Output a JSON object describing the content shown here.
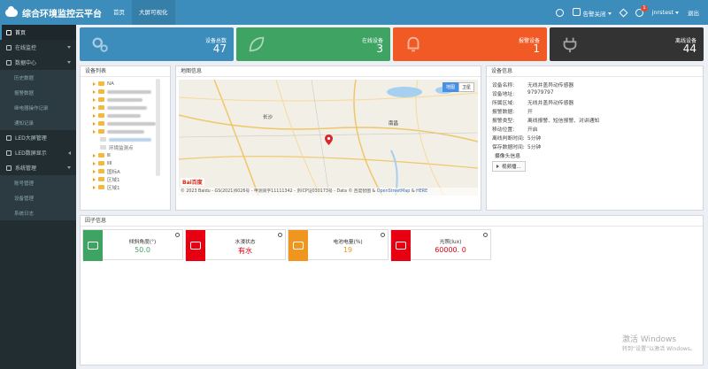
{
  "app": {
    "title": "综合环境监控云平台"
  },
  "header": {
    "tabs": [
      {
        "label": "首页"
      },
      {
        "label": "大屏可视化"
      }
    ],
    "alarm_label": "告警关闭",
    "notification_count": "1",
    "username": "jnrstest",
    "logout_label": "退出"
  },
  "sidebar": {
    "items": [
      {
        "label": "首页"
      },
      {
        "label": "在线监控"
      },
      {
        "label": "数据中心"
      },
      {
        "label": "历史数据"
      },
      {
        "label": "报警数据"
      },
      {
        "label": "继电器操作记录"
      },
      {
        "label": "通知记录"
      },
      {
        "label": "LED大屏管理"
      },
      {
        "label": "LED数屏显示"
      },
      {
        "label": "系统管理"
      },
      {
        "label": "账号管理"
      },
      {
        "label": "设备管理"
      },
      {
        "label": "系统日志"
      }
    ]
  },
  "stats": [
    {
      "label": "设备总数",
      "value": "47",
      "color": "#3c8dbc"
    },
    {
      "label": "在线设备",
      "value": "3",
      "color": "#3fa463"
    },
    {
      "label": "报警设备",
      "value": "1",
      "color": "#f15a25"
    },
    {
      "label": "离线设备",
      "value": "44",
      "color": "#333333"
    }
  ],
  "device_list": {
    "title": "设备列表",
    "tree_visible_labels": {
      "r1": "NA",
      "r9": "环境监测点",
      "r10": "Ⅲ",
      "r11": "ⅡⅡ",
      "r12": "国标A",
      "r13": "区域1",
      "r14": "区域1"
    }
  },
  "map_panel": {
    "title": "地图信息",
    "type_map": "地图",
    "type_sat": "卫星",
    "city1": "长沙",
    "city2": "南昌",
    "footer_prefix": "© 2023 Baidu - GS(2021)6026号 - 甲测资字11111342 - 京ICP证030173号 - Data © 百度智图 &",
    "footer_link1": "OpenStreetMap",
    "footer_and": "&",
    "footer_link2": "HERE",
    "logo": "Bai百度"
  },
  "device_info": {
    "title": "设备信息",
    "rows": [
      {
        "k": "设备名称:",
        "v": "无线井盖异动传感器"
      },
      {
        "k": "设备地址:",
        "v": "97979797"
      },
      {
        "k": "所属区域:",
        "v": "无线井盖异动传感器"
      },
      {
        "k": "报警数据:",
        "v": "开"
      },
      {
        "k": "报警类型:",
        "v": "离线报警、短信报警、对讲通知"
      },
      {
        "k": "移动位置:",
        "v": "开启"
      },
      {
        "k": "离线判断时间:",
        "v": "5分钟"
      },
      {
        "k": "保存数据时间:",
        "v": "5分钟"
      }
    ],
    "camera_label": "摄像头信息",
    "video_button": "视频播..."
  },
  "factor_panel": {
    "title": "因子信息"
  },
  "sensors": [
    {
      "name": "倾斜角度(°)",
      "value": "50.0",
      "color": "#3fa463"
    },
    {
      "name": "水浸状态",
      "value": "有水",
      "color": "#e60012"
    },
    {
      "name": "电池电量(%)",
      "value": "19",
      "color": "#f0961e"
    },
    {
      "name": "光照(lux)",
      "value": "60000. 0",
      "color": "#e60012"
    }
  ],
  "watermark": {
    "line1": "激活 Windows",
    "line2": "转到“设置”以激活 Windows。"
  }
}
